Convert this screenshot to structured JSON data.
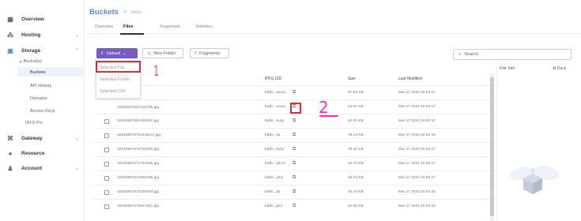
{
  "sidebar": {
    "items": [
      {
        "label": "Overview",
        "icon": "grid-icon"
      },
      {
        "label": "Hosting",
        "icon": "hosting-icon"
      },
      {
        "label": "Storage",
        "icon": "storage-icon"
      },
      {
        "label": "Gateway",
        "icon": "gateway-icon"
      },
      {
        "label": "Resource",
        "icon": "info-icon"
      },
      {
        "label": "Account",
        "icon": "account-icon"
      }
    ],
    "storage_group": "Bucket(s)",
    "sub_items": [
      "Buckets",
      "API History",
      "Domains",
      "Access Keys",
      "IPFS Pin"
    ]
  },
  "breadcrumb": {
    "title": "Buckets",
    "separator": ">",
    "current": "kbcke"
  },
  "tabs": [
    "Overview",
    "Files",
    "Snapshots",
    "Statistics"
  ],
  "active_tab": "Files",
  "toolbar": {
    "upload": "Upload",
    "new_folder": "New Folder",
    "fragments": "Fragments"
  },
  "dropdown": [
    "Selected File",
    "Selected Folder",
    "Selected CID"
  ],
  "search": {
    "placeholder": "Search"
  },
  "table": {
    "headers": {
      "cid": "IPFS CID",
      "size": "Size",
      "modified": "Last Modified"
    },
    "rows": [
      {
        "name": "",
        "cid": "bafkr...weua",
        "size": "67.89 KB",
        "modified": "Mar 17 2023 16:53:17",
        "checkbox": false
      },
      {
        "name": "",
        "cid": "bafkr...ewua",
        "size": "64.02 KB",
        "modified": "Mar 17 2023 16:53:17",
        "checkbox": false
      },
      {
        "name": "16240867661549087.jpg",
        "cid": "bafkr...6uzy",
        "size": "62.04 KB",
        "modified": "Mar 17 2023 16:53:17",
        "checkbox": true
      },
      {
        "name": "162408676711341137.jpg",
        "cid": "bafkr...tiq",
        "size": "76.23 KB",
        "modified": "Mar 17 2023 16:53:16",
        "checkbox": true
      },
      {
        "name": "16240867572722825.jpg",
        "cid": "bafkr...bvvy",
        "size": "79.45 KB",
        "modified": "Mar 17 2023 16:53:17",
        "checkbox": true
      },
      {
        "name": "16240867571791538.jpg",
        "cid": "bafkr...ybcm",
        "size": "82.76 KB",
        "modified": "Mar 17 2023 16:53:17",
        "checkbox": true
      },
      {
        "name": "16240867574492396.jpg",
        "cid": "bafkr...y3rs",
        "size": "49.03 KB",
        "modified": "Mar 17 2023 16:53:17",
        "checkbox": true
      },
      {
        "name": "16240867575328684.jpg",
        "cid": "bafkr...dii",
        "size": "30.44 KB",
        "modified": "Mar 17 2023 16:53:16",
        "checkbox": true
      },
      {
        "name": "16240867576547321.jpg",
        "cid": "bafkr...jbra",
        "size": "61.50 KB",
        "modified": "Mar 17 2023 16:53:16",
        "checkbox": true
      }
    ],
    "first_row_partial_name": "16240867667133795.jpg"
  },
  "info_panel": {
    "title": "File Info",
    "docs": "Docs"
  },
  "annotations": {
    "one": "1",
    "two": "2"
  },
  "colors": {
    "accent": "#7a58c8",
    "link": "#5a8dd0",
    "annotation_box": "#e02a3a",
    "annotation_text": "#ff2db0"
  }
}
